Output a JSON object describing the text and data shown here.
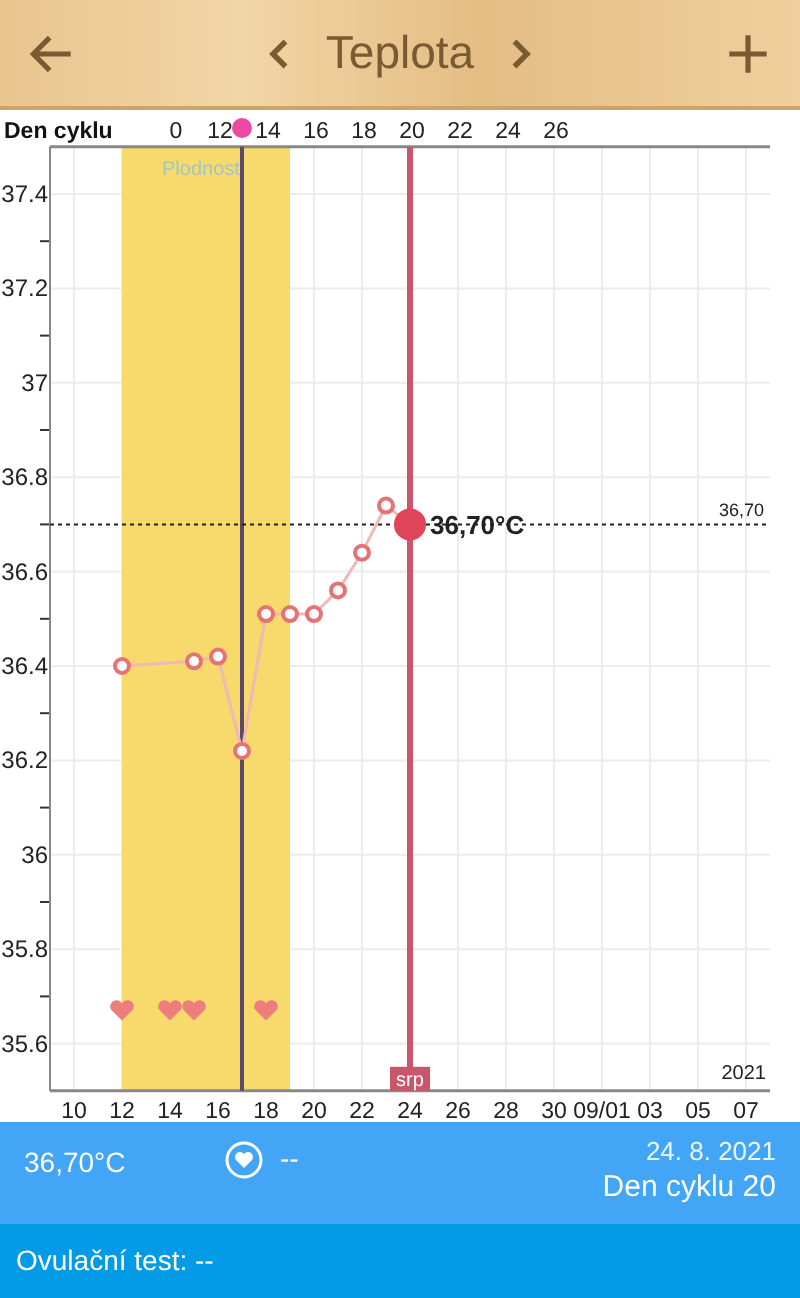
{
  "header": {
    "title": "Teplota"
  },
  "chart": {
    "cycle_day_label": "Den cyklu",
    "cycle_day_ticks": [
      "0",
      "12",
      "14",
      "16",
      "18",
      "20",
      "22",
      "24",
      "26"
    ],
    "year": "2021",
    "chart_data": {
      "type": "line",
      "x": [
        "2021-08-12",
        "2021-08-14",
        "2021-08-15",
        "2021-08-16",
        "2021-08-17",
        "2021-08-18",
        "2021-08-19",
        "2021-08-20",
        "2021-08-21",
        "2021-08-22",
        "2021-08-23",
        "2021-08-24"
      ],
      "series": [
        {
          "color": "#e57373",
          "marker": "circle",
          "values": [
            36.4,
            null,
            36.41,
            36.42,
            36.22,
            36.51,
            36.51,
            36.51,
            36.56,
            36.64,
            36.74,
            36.7
          ]
        },
        {
          "type": "scatter",
          "color": "#ee7d7d",
          "values": [
            35.67,
            35.67,
            35.67,
            null,
            null,
            35.67,
            null,
            null,
            null,
            null,
            null,
            null
          ]
        }
      ],
      "grid": true,
      "xlim": [
        "2021-08-09",
        "2021-09-08"
      ],
      "ylim": [
        35.5,
        37.5
      ],
      "xticks": [
        {
          "value": "2021-08-10",
          "label": "10"
        },
        {
          "value": "2021-08-12",
          "label": "12"
        },
        {
          "value": "2021-08-14",
          "label": "14"
        },
        {
          "value": "2021-08-16",
          "label": "16"
        },
        {
          "value": "2021-08-18",
          "label": "18"
        },
        {
          "value": "2021-08-20",
          "label": "20"
        },
        {
          "value": "2021-08-22",
          "label": "22"
        },
        {
          "value": "2021-08-24",
          "label": "24"
        },
        {
          "value": "2021-08-26",
          "label": "26"
        },
        {
          "value": "2021-08-28",
          "label": "28"
        },
        {
          "value": "2021-08-30",
          "label": "30"
        },
        {
          "value": "2021-09-01",
          "label": "09/01"
        },
        {
          "value": "2021-09-03",
          "label": "03"
        },
        {
          "value": "2021-09-05",
          "label": "05"
        },
        {
          "value": "2021-09-07",
          "label": "07"
        }
      ],
      "yticks": [
        {
          "value": 35.6,
          "label": "35.6"
        },
        {
          "value": 35.8,
          "label": "35.8"
        },
        {
          "value": 36,
          "label": "36"
        },
        {
          "value": 36.2,
          "label": "36.2"
        },
        {
          "value": 36.4,
          "label": "36.4"
        },
        {
          "value": 36.6,
          "label": "36.6"
        },
        {
          "value": 36.8,
          "label": "36.8"
        },
        {
          "value": 37,
          "label": "37"
        },
        {
          "value": 37.2,
          "label": "37.2"
        },
        {
          "value": 37.4,
          "label": "37.4"
        }
      ],
      "bands": [
        {
          "axis": "x",
          "from": "2021-08-12",
          "to": "2021-08-19",
          "label": "Plodnost"
        }
      ],
      "ref_lines": [
        {
          "axis": "x",
          "value": "2021-08-17"
        },
        {
          "axis": "y",
          "value": 36.7,
          "label": "36,70"
        },
        {
          "axis": "x",
          "value": "2021-08-24",
          "label": "srp"
        }
      ],
      "annotations": [
        {
          "x": "2021-08-24",
          "y": 36.7,
          "text": "36,70°C"
        }
      ]
    }
  },
  "summary": {
    "temperature": "36,70°C",
    "intercourse": "--",
    "date": "24. 8. 2021",
    "cycle_day": "Den cyklu 20"
  },
  "ovulation_test": "Ovulační test: --"
}
